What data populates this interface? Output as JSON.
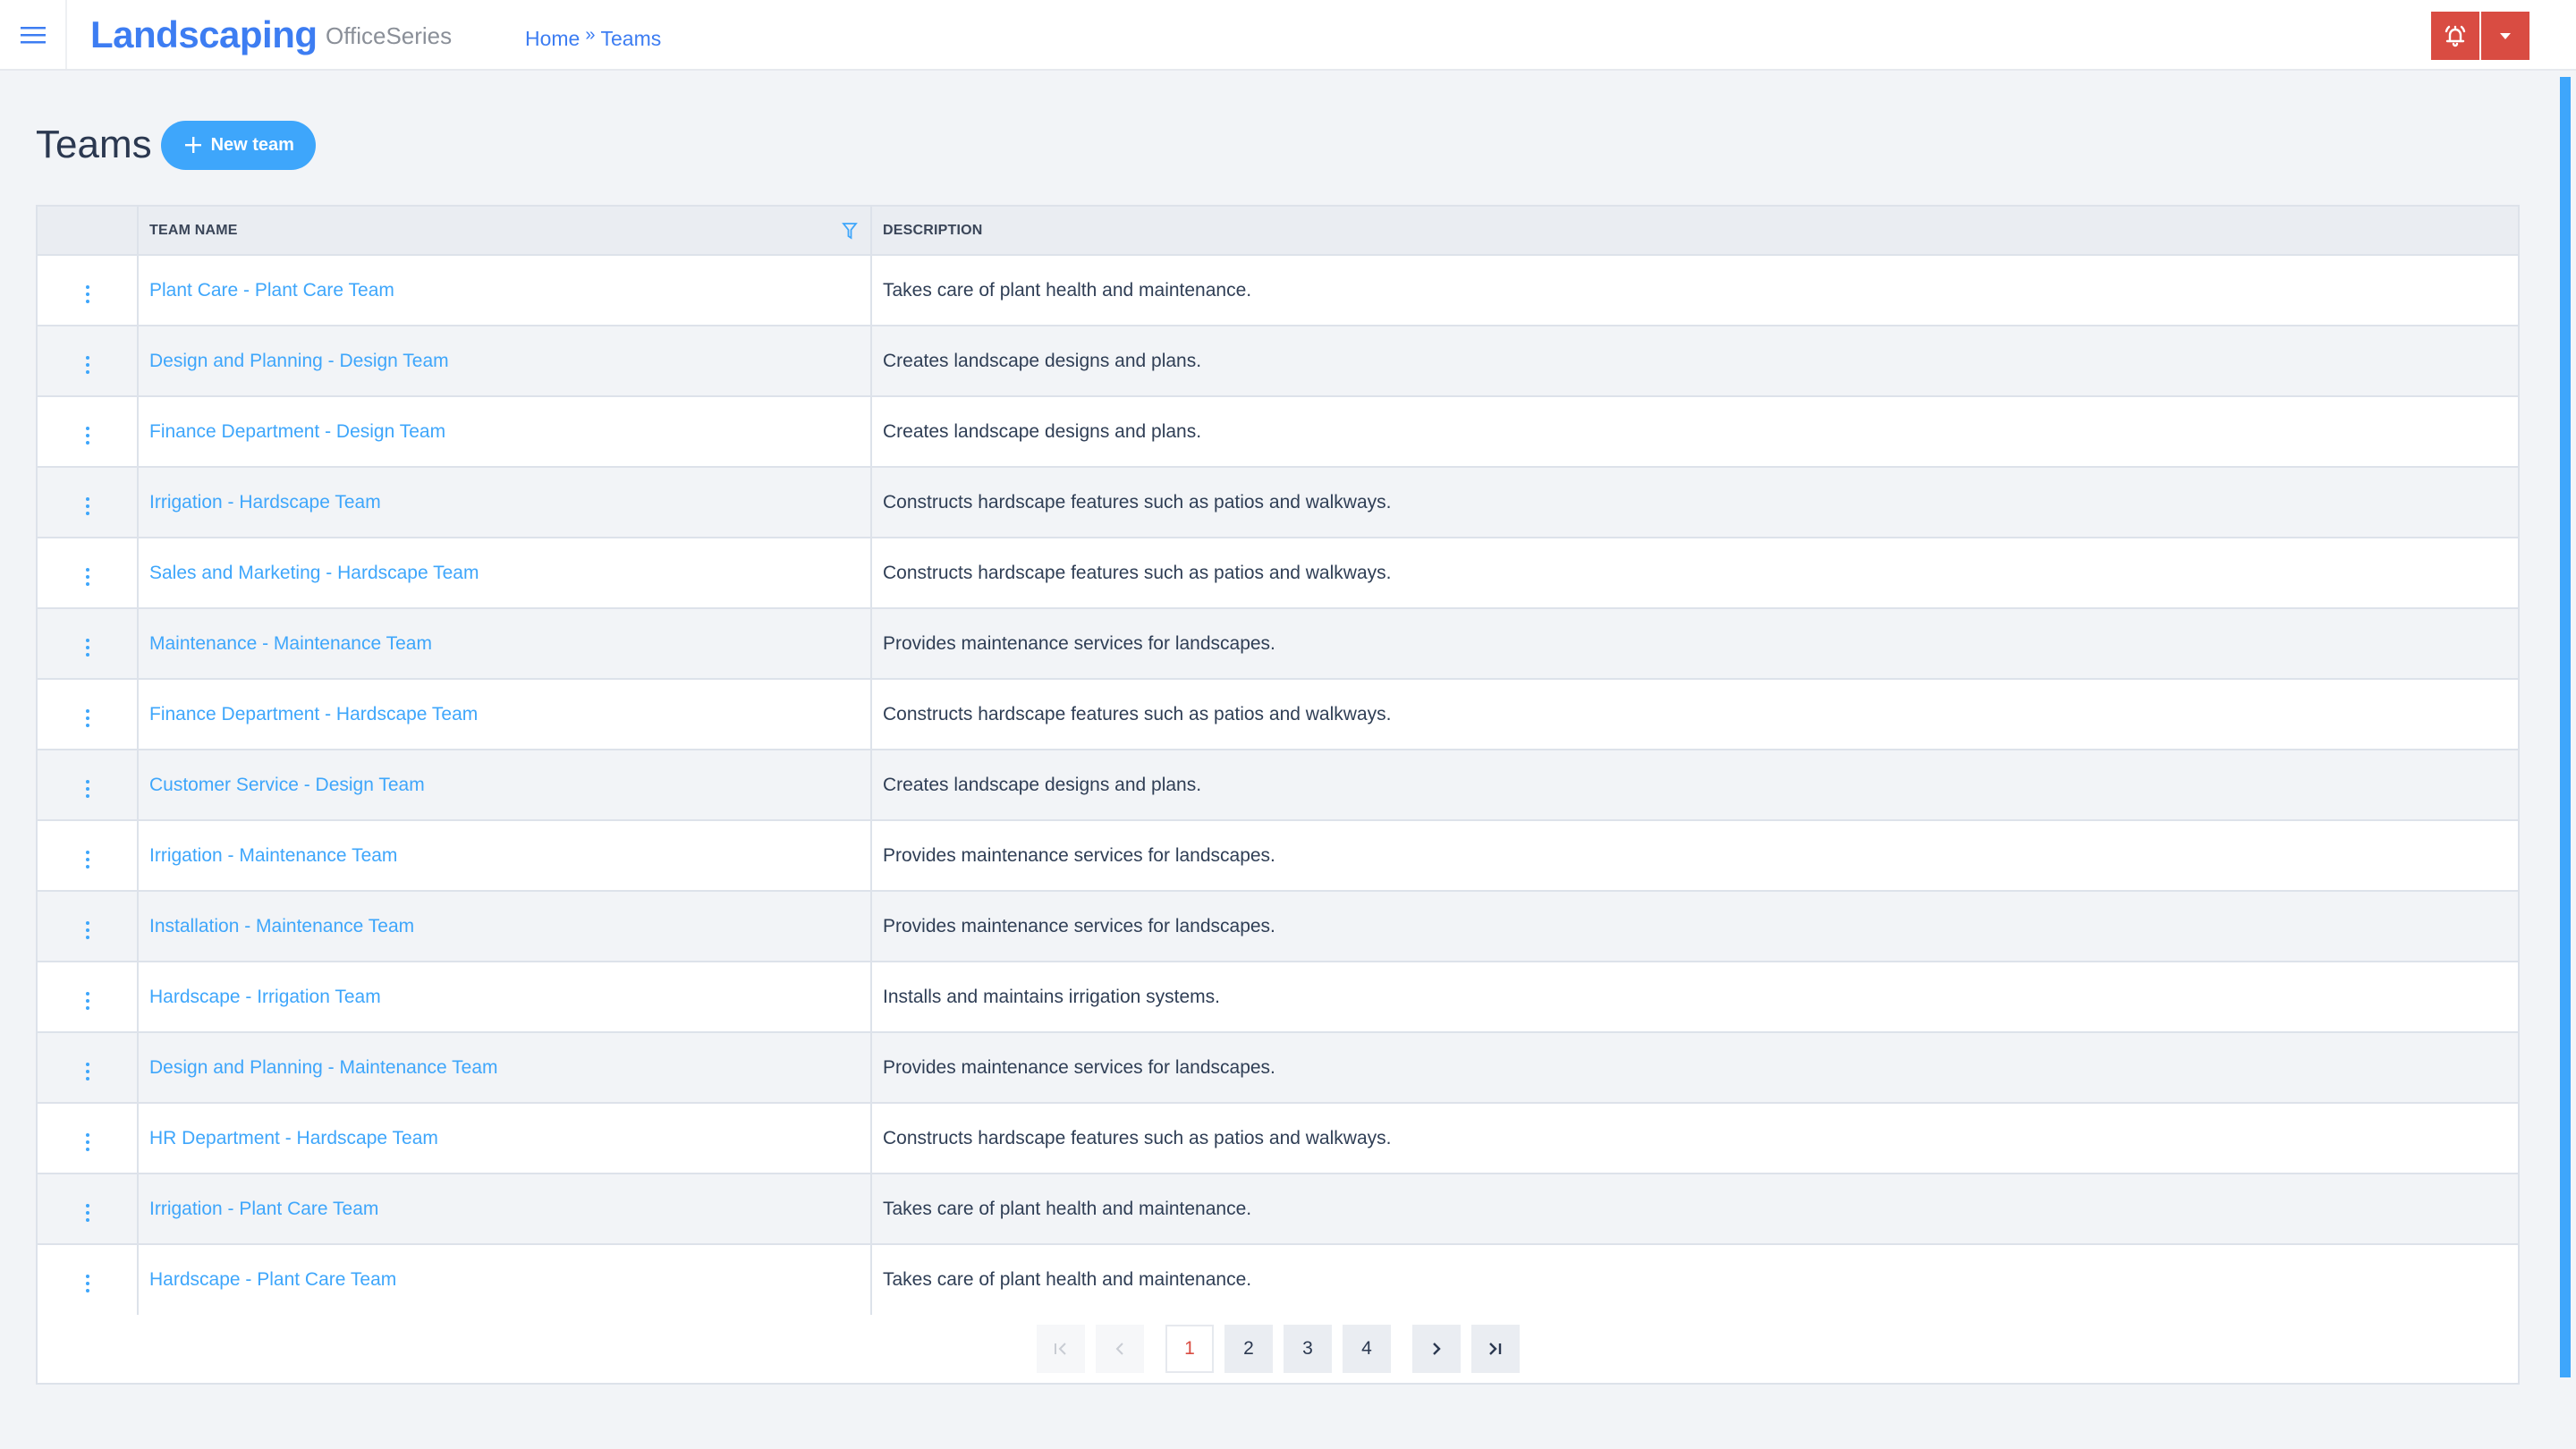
{
  "header": {
    "menu_icon": "hamburger-menu-icon",
    "brand": "Landscaping",
    "suite": "OfficeSeries",
    "breadcrumb": [
      {
        "label": "Home"
      },
      {
        "label": "Teams"
      }
    ],
    "breadcrumb_separator": "»",
    "actions": [
      {
        "icon": "bell-ringing-icon",
        "label": "Notifications"
      },
      {
        "icon": "caret-down-icon",
        "label": "User menu"
      }
    ],
    "accent_color": "#d94c42"
  },
  "page": {
    "title": "Teams",
    "new_button_label": "New team",
    "brand_color": "#3d7df2",
    "button_color": "#3ea6fb"
  },
  "table": {
    "columns": [
      "",
      "TEAM NAME",
      "DESCRIPTION"
    ],
    "filter_icon": "filter-funnel-icon",
    "rows": [
      {
        "name": "Plant Care - Plant Care Team",
        "description": "Takes care of plant health and maintenance."
      },
      {
        "name": "Design and Planning - Design Team",
        "description": "Creates landscape designs and plans."
      },
      {
        "name": "Finance Department - Design Team",
        "description": "Creates landscape designs and plans."
      },
      {
        "name": "Irrigation - Hardscape Team",
        "description": "Constructs hardscape features such as patios and walkways."
      },
      {
        "name": "Sales and Marketing - Hardscape Team",
        "description": "Constructs hardscape features such as patios and walkways."
      },
      {
        "name": "Maintenance - Maintenance Team",
        "description": "Provides maintenance services for landscapes."
      },
      {
        "name": "Finance Department - Hardscape Team",
        "description": "Constructs hardscape features such as patios and walkways."
      },
      {
        "name": "Customer Service - Design Team",
        "description": "Creates landscape designs and plans."
      },
      {
        "name": "Irrigation - Maintenance Team",
        "description": "Provides maintenance services for landscapes."
      },
      {
        "name": "Installation - Maintenance Team",
        "description": "Provides maintenance services for landscapes."
      },
      {
        "name": "Hardscape - Irrigation Team",
        "description": "Installs and maintains irrigation systems."
      },
      {
        "name": "Design and Planning - Maintenance Team",
        "description": "Provides maintenance services for landscapes."
      },
      {
        "name": "HR Department - Hardscape Team",
        "description": "Constructs hardscape features such as patios and walkways."
      },
      {
        "name": "Irrigation - Plant Care Team",
        "description": "Takes care of plant health and maintenance."
      },
      {
        "name": "Hardscape - Plant Care Team",
        "description": "Takes care of plant health and maintenance."
      }
    ]
  },
  "pagination": {
    "current_page": 1,
    "pages": [
      "1",
      "2",
      "3",
      "4"
    ],
    "first_icon": "first-page-icon",
    "prev_icon": "chevron-left-icon",
    "next_icon": "chevron-right-icon",
    "last_icon": "last-page-icon",
    "first_disabled": true,
    "prev_disabled": true
  }
}
